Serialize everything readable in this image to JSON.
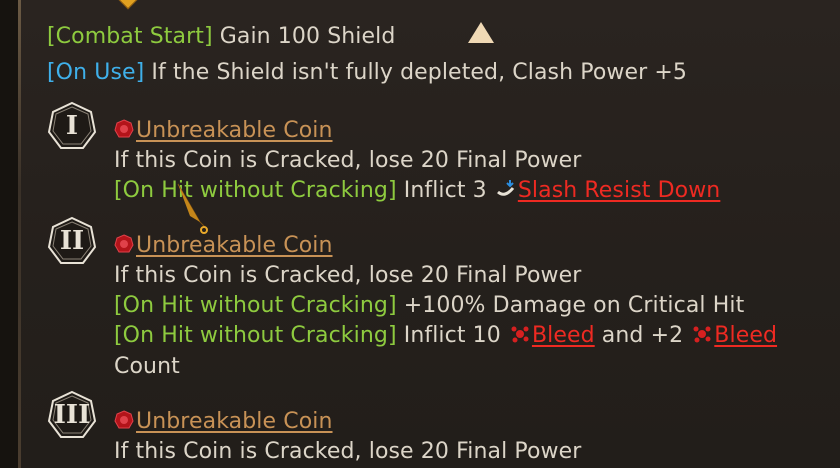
{
  "skill": {
    "combat_start_tag": "[Combat Start]",
    "combat_start_text": " Gain 100 Shield",
    "on_use_tag": "[On Use]",
    "on_use_text": " If the Shield isn't fully depleted, Clash Power +5"
  },
  "coins": [
    {
      "numeral": "I",
      "name": "Unbreakable Coin",
      "crack_text": "If this Coin is Cracked, lose 20 Final Power",
      "effects": [
        {
          "tag": "[On Hit without Cracking]",
          "text": " Inflict 3 ",
          "keyword": "Slash Resist Down",
          "icon": "slash-resist-down-icon"
        }
      ]
    },
    {
      "numeral": "II",
      "name": "Unbreakable Coin",
      "crack_text": "If this Coin is Cracked, lose 20 Final Power",
      "effects": [
        {
          "tag": "[On Hit without Cracking]",
          "text": " +100% Damage on Critical Hit"
        },
        {
          "tag": "[On Hit without Cracking]",
          "text": " Inflict 10 ",
          "keyword": "Bleed",
          "mid_text": " and +2 ",
          "keyword2": "Bleed",
          "tail": "Count",
          "icon": "bleed-icon"
        }
      ]
    },
    {
      "numeral": "III",
      "name": "Unbreakable Coin",
      "crack_text": "If this Coin is Cracked, lose 20 Final Power"
    }
  ],
  "colors": {
    "tag_green": "#8ecb3f",
    "tag_blue": "#3fb0ea",
    "coin_name": "#c89256",
    "keyword_red": "#ee2a22",
    "body_text": "#dcd5c8"
  }
}
